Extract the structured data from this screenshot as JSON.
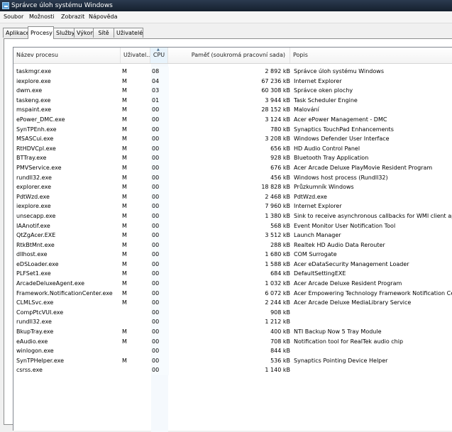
{
  "window": {
    "title": "Správce úloh systému Windows"
  },
  "menu": [
    "Soubor",
    "Možnosti",
    "Zobrazit",
    "Nápověda"
  ],
  "tabs": [
    "Aplikace",
    "Procesy",
    "Služby",
    "Výkon",
    "Sítě",
    "Uživatelé"
  ],
  "active_tab": "Procesy",
  "columns": {
    "name": "Název procesu",
    "user": "Uživatel...",
    "cpu": "CPU",
    "memory": "Paměť (soukromá pracovní sada)",
    "description": "Popis"
  },
  "processes": [
    {
      "name": "taskmgr.exe",
      "user": "M",
      "cpu": "08",
      "memory": "2 892 kB",
      "description": "Správce úloh systému Windows"
    },
    {
      "name": "iexplore.exe",
      "user": "M",
      "cpu": "04",
      "memory": "67 236 kB",
      "description": "Internet Explorer"
    },
    {
      "name": "dwm.exe",
      "user": "M",
      "cpu": "03",
      "memory": "60 308 kB",
      "description": "Správce oken plochy"
    },
    {
      "name": "taskeng.exe",
      "user": "M",
      "cpu": "01",
      "memory": "3 944 kB",
      "description": "Task Scheduler Engine"
    },
    {
      "name": "mspaint.exe",
      "user": "M",
      "cpu": "00",
      "memory": "28 152 kB",
      "description": "Malování"
    },
    {
      "name": "ePower_DMC.exe",
      "user": "M",
      "cpu": "00",
      "memory": "3 124 kB",
      "description": "Acer ePower Management - DMC"
    },
    {
      "name": "SynTPEnh.exe",
      "user": "M",
      "cpu": "00",
      "memory": "780 kB",
      "description": "Synaptics TouchPad Enhancements"
    },
    {
      "name": "MSASCui.exe",
      "user": "M",
      "cpu": "00",
      "memory": "3 208 kB",
      "description": "Windows Defender User Interface"
    },
    {
      "name": "RtHDVCpl.exe",
      "user": "M",
      "cpu": "00",
      "memory": "656 kB",
      "description": "HD Audio Control Panel"
    },
    {
      "name": "BTTray.exe",
      "user": "M",
      "cpu": "00",
      "memory": "928 kB",
      "description": "Bluetooth Tray Application"
    },
    {
      "name": "PMVService.exe",
      "user": "M",
      "cpu": "00",
      "memory": "676 kB",
      "description": "Acer Arcade Deluxe PlayMovie Resident Program"
    },
    {
      "name": "rundll32.exe",
      "user": "M",
      "cpu": "00",
      "memory": "456 kB",
      "description": "Windows host process (Rundll32)"
    },
    {
      "name": "explorer.exe",
      "user": "M",
      "cpu": "00",
      "memory": "18 828 kB",
      "description": "Průzkumník Windows"
    },
    {
      "name": "PdtWzd.exe",
      "user": "M",
      "cpu": "00",
      "memory": "2 468 kB",
      "description": "PdtWzd.exe"
    },
    {
      "name": "iexplore.exe",
      "user": "M",
      "cpu": "00",
      "memory": "7 960 kB",
      "description": "Internet Explorer"
    },
    {
      "name": "unsecapp.exe",
      "user": "M",
      "cpu": "00",
      "memory": "1 380 kB",
      "description": "Sink to receive asynchronous callbacks for WMI client application"
    },
    {
      "name": "IAAnotif.exe",
      "user": "M",
      "cpu": "00",
      "memory": "568 kB",
      "description": "Event Monitor User Notification Tool"
    },
    {
      "name": "QtZgAcer.EXE",
      "user": "M",
      "cpu": "00",
      "memory": "3 512 kB",
      "description": "Launch Manager"
    },
    {
      "name": "RtkBtMnt.exe",
      "user": "M",
      "cpu": "00",
      "memory": "288 kB",
      "description": "Realtek HD Audio Data Rerouter"
    },
    {
      "name": "dllhost.exe",
      "user": "M",
      "cpu": "00",
      "memory": "1 680 kB",
      "description": "COM Surrogate"
    },
    {
      "name": "eDSLoader.exe",
      "user": "M",
      "cpu": "00",
      "memory": "1 588 kB",
      "description": "Acer eDataSecurity Management Loader"
    },
    {
      "name": "PLFSet1.exe",
      "user": "M",
      "cpu": "00",
      "memory": "684 kB",
      "description": "DefaultSettingEXE"
    },
    {
      "name": "ArcadeDeluxeAgent.exe",
      "user": "M",
      "cpu": "00",
      "memory": "1 032 kB",
      "description": "Acer Arcade Deluxe Resident Program"
    },
    {
      "name": "Framework.NotificationCenter.exe",
      "user": "M",
      "cpu": "00",
      "memory": "6 072 kB",
      "description": "Acer Empowering Technology Framework Notification Center"
    },
    {
      "name": "CLMLSvc.exe",
      "user": "M",
      "cpu": "00",
      "memory": "2 244 kB",
      "description": "Acer Arcade Deluxe MediaLibrary Service"
    },
    {
      "name": "CompPtcVUI.exe",
      "user": "",
      "cpu": "00",
      "memory": "908 kB",
      "description": ""
    },
    {
      "name": "rundll32.exe",
      "user": "",
      "cpu": "00",
      "memory": "1 212 kB",
      "description": ""
    },
    {
      "name": "BkupTray.exe",
      "user": "M",
      "cpu": "00",
      "memory": "400 kB",
      "description": "NTI Backup Now 5 Tray Module"
    },
    {
      "name": "eAudio.exe",
      "user": "M",
      "cpu": "00",
      "memory": "708 kB",
      "description": "Notification tool for RealTek audio chip"
    },
    {
      "name": "winlogon.exe",
      "user": "",
      "cpu": "00",
      "memory": "844 kB",
      "description": ""
    },
    {
      "name": "SynTPHelper.exe",
      "user": "M",
      "cpu": "00",
      "memory": "536 kB",
      "description": "Synaptics Pointing Device Helper"
    },
    {
      "name": "csrss.exe",
      "user": "",
      "cpu": "00",
      "memory": "1 140 kB",
      "description": ""
    }
  ]
}
